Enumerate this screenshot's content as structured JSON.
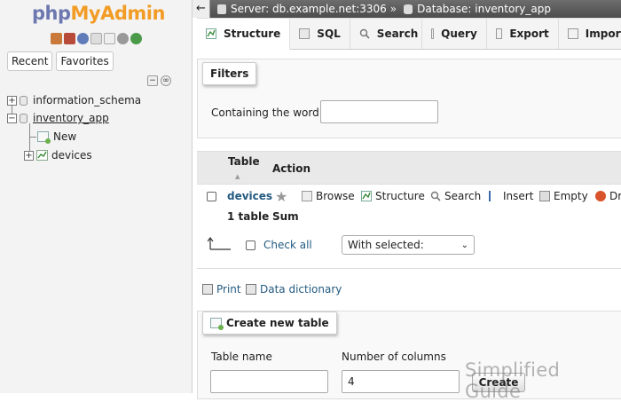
{
  "logo": {
    "php": "php",
    "myadmin": "MyAdmin"
  },
  "nav_tabs": [
    "Recent",
    "Favorites"
  ],
  "tree": {
    "db1": "information_schema",
    "db2": "inventory_app",
    "new": "New",
    "table1": "devices"
  },
  "breadcrumb": {
    "server": "Server: db.example.net:3306",
    "sep": "»",
    "database": "Database: inventory_app"
  },
  "tabs": [
    "Structure",
    "SQL",
    "Search",
    "Query",
    "Export",
    "Import"
  ],
  "filters": {
    "title": "Filters",
    "label": "Containing the word:",
    "value": ""
  },
  "table_list": {
    "col_table": "Table",
    "col_action": "Action",
    "row": {
      "name": "devices",
      "actions": [
        "Browse",
        "Structure",
        "Search",
        "Insert",
        "Empty",
        "Dr"
      ]
    },
    "summary": {
      "count": "1 table",
      "sum": "Sum"
    },
    "check_all": "Check all",
    "with_selected": "With selected:"
  },
  "links": {
    "print": "Print",
    "data_dictionary": "Data dictionary"
  },
  "create": {
    "title": "Create new table",
    "table_name_label": "Table name",
    "columns_label": "Number of columns",
    "columns_value": "4",
    "button": "Create"
  },
  "watermark": "Simplified Guide",
  "colors": {
    "logo_php": "#6c78af",
    "logo_myadmin": "#f29c26",
    "topbar": "#5a5a5a"
  }
}
